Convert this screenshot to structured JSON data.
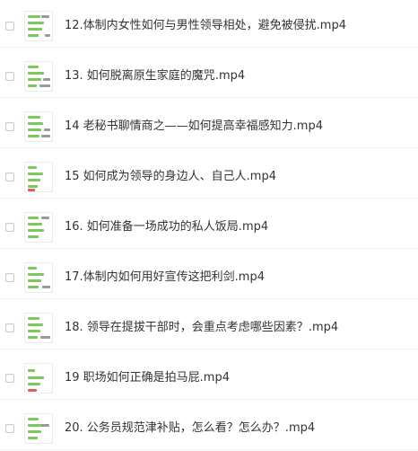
{
  "file_list": {
    "items": [
      {
        "name": "12.体制内女性如何与男性领导相处，避免被侵扰.mp4"
      },
      {
        "name": "13. 如何脱离原生家庭的魔咒.mp4"
      },
      {
        "name": "14 老秘书聊情商之——如何提高幸福感知力.mp4"
      },
      {
        "name": "15 如何成为领导的身边人、自己人.mp4"
      },
      {
        "name": "16. 如何准备一场成功的私人饭局.mp4"
      },
      {
        "name": "17.体制内如何用好宣传这把利剑.mp4"
      },
      {
        "name": "18. 领导在提拔干部时，会重点考虑哪些因素？.mp4"
      },
      {
        "name": "19 职场如何正确是拍马屁.mp4"
      },
      {
        "name": "20. 公务员规范津补贴，怎么看？怎么办？.mp4"
      }
    ]
  },
  "colors": {
    "thumb_green": "#7cc85a",
    "thumb_gray": "#9a9a9a",
    "thumb_red": "#e25c5c",
    "text": "#333333"
  },
  "icons": {
    "checkbox": "checkbox-icon",
    "thumbnail": "video-thumbnail-icon"
  }
}
